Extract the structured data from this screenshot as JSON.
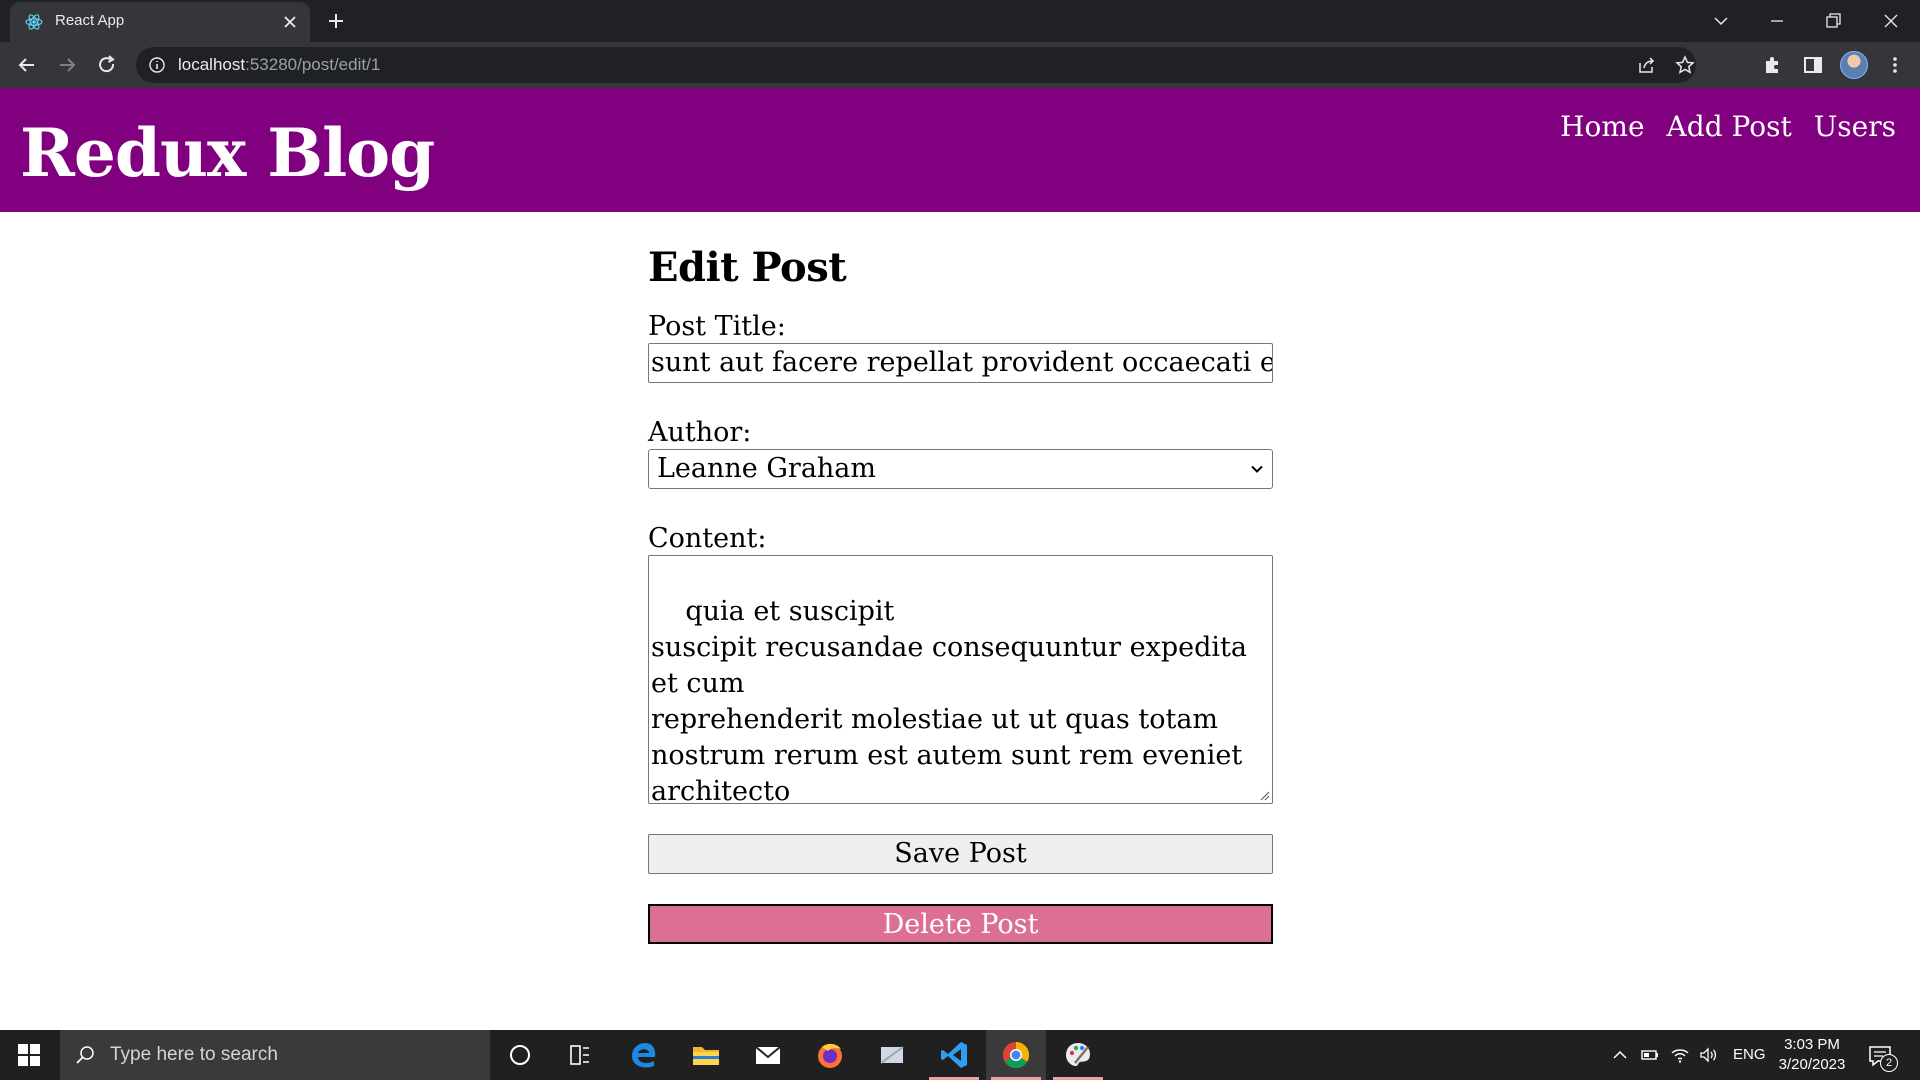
{
  "browser": {
    "tab_title": "React App",
    "url_host": "localhost",
    "url_rest": ":53280/post/edit/1"
  },
  "app": {
    "title": "Redux Blog",
    "nav": [
      "Home",
      "Add Post",
      "Users"
    ],
    "accent_color": "#800080"
  },
  "form": {
    "heading": "Edit Post",
    "title_label": "Post Title:",
    "title_value": "sunt aut facere repellat provident occaecati excepturi optio reprehenderit",
    "author_label": "Author:",
    "author_selected": "Leanne Graham",
    "content_label": "Content:",
    "content_value": "quia et suscipit\nsuscipit recusandae consequuntur expedita et cum\nreprehenderit molestiae ut ut quas totam\nnostrum rerum est autem sunt rem eveniet architecto",
    "save_label": "Save Post",
    "delete_label": "Delete Post",
    "delete_color": "#db7093"
  },
  "taskbar": {
    "search_placeholder": "Type here to search",
    "language": "ENG",
    "time": "3:03 PM",
    "date": "3/20/2023",
    "notification_count": "2",
    "apps": [
      "cortana-icon",
      "task-view-icon",
      "edge-icon",
      "file-explorer-icon",
      "mail-icon",
      "firefox-icon",
      "windows-app-icon",
      "vscode-icon",
      "chrome-icon",
      "paint-icon"
    ]
  }
}
